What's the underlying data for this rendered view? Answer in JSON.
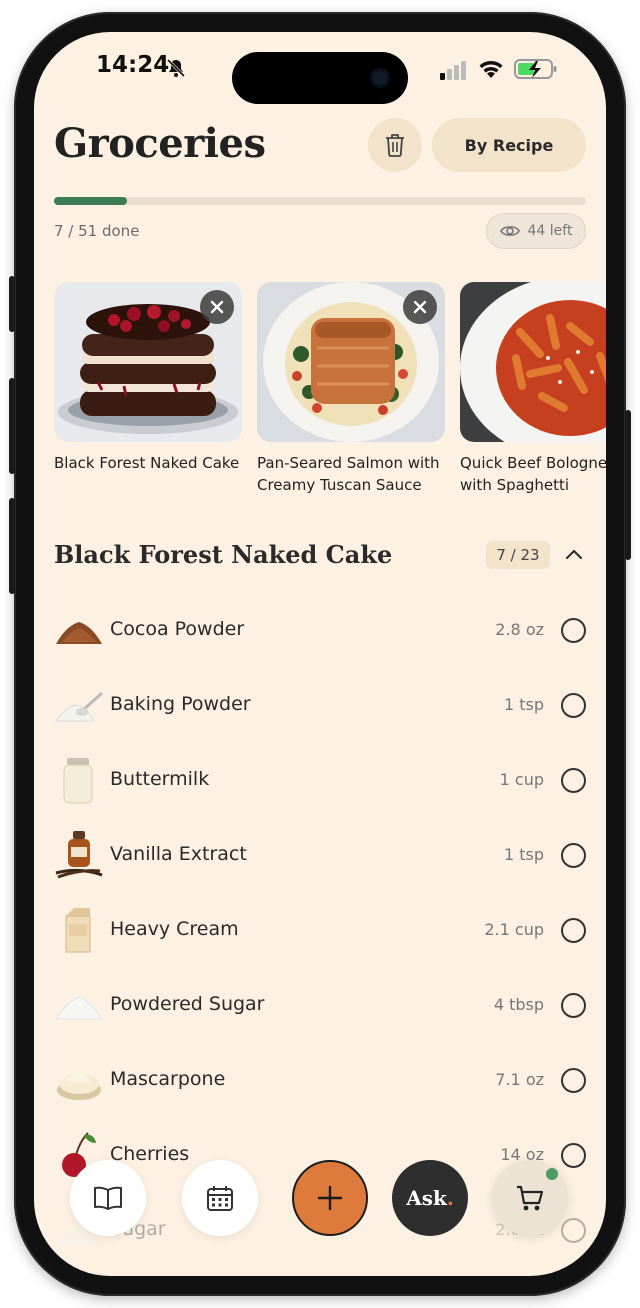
{
  "status_bar": {
    "time": "14:24"
  },
  "header": {
    "title": "Groceries",
    "by_recipe_label": "By Recipe"
  },
  "progress": {
    "done_text": "7 / 51 done",
    "fraction": 0.137,
    "left_label": "44 left"
  },
  "recipes": [
    {
      "name_line1": "Black Forest Naked Cake",
      "name_line2": ""
    },
    {
      "name_line1": "Pan-Seared Salmon with",
      "name_line2": "Creamy Tuscan Sauce"
    },
    {
      "name_line1": "Quick Beef Bologne",
      "name_line2": "with Spaghetti"
    }
  ],
  "section": {
    "title": "Black Forest Naked Cake",
    "count": "7 / 23"
  },
  "ingredients": [
    {
      "name": "Cocoa Powder",
      "qty": "2.8 oz",
      "icon": "cocoa-powder-icon"
    },
    {
      "name": "Baking Powder",
      "qty": "1 tsp",
      "icon": "baking-powder-icon"
    },
    {
      "name": "Buttermilk",
      "qty": "1 cup",
      "icon": "buttermilk-icon"
    },
    {
      "name": "Vanilla Extract",
      "qty": "1 tsp",
      "icon": "vanilla-extract-icon"
    },
    {
      "name": "Heavy Cream",
      "qty": "2.1 cup",
      "icon": "heavy-cream-icon"
    },
    {
      "name": "Powdered Sugar",
      "qty": "4 tbsp",
      "icon": "powdered-sugar-icon"
    },
    {
      "name": "Mascarpone",
      "qty": "7.1 oz",
      "icon": "mascarpone-icon"
    },
    {
      "name": "Cherries",
      "qty": "14 oz",
      "icon": "cherries-icon"
    },
    {
      "name": "Sugar",
      "qty": "2.6 oz",
      "icon": "sugar-icon"
    }
  ],
  "bottom_nav": {
    "ask_label": "Ask",
    "ask_dot": "."
  },
  "colors": {
    "background": "#fcf1e2",
    "accent_orange": "#dd7a3c",
    "progress_green": "#3b7c54",
    "chip_beige": "#f3e3cb"
  }
}
